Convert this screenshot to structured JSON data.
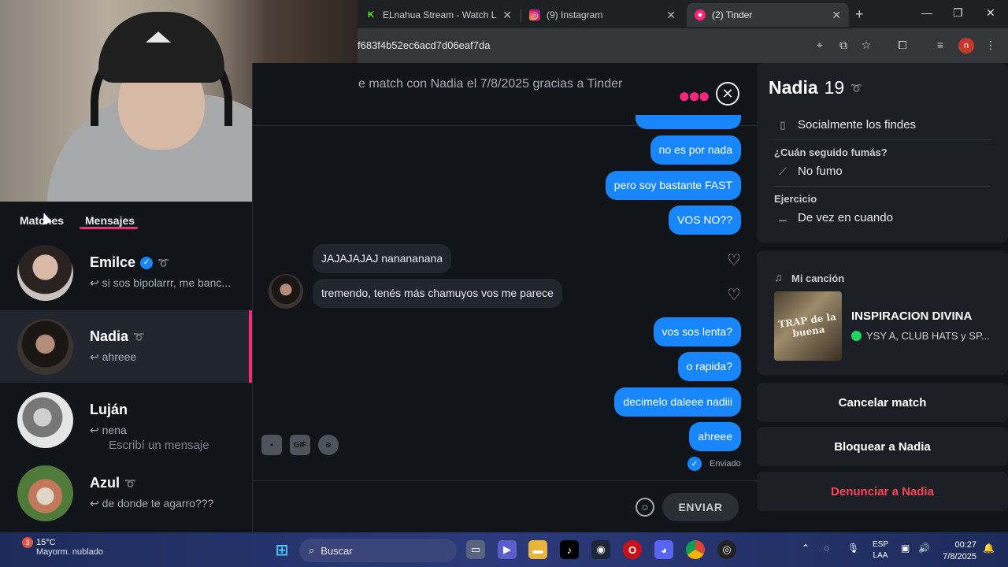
{
  "browser": {
    "tabs": [
      {
        "title": "ELnahua Stream - Watch Live",
        "favicon": "kick-icon",
        "active": false
      },
      {
        "title": "(9) Instagram",
        "favicon": "instagram-icon",
        "active": false
      },
      {
        "title": "(2) Tinder",
        "favicon": "tinder-icon",
        "active": true
      }
    ],
    "url": "f683f4b52ec6acd7d06eaf7da",
    "profile_initial": "n"
  },
  "sidebar": {
    "tab_matches": "Matches",
    "tab_messages": "Mensajes",
    "conversations": [
      {
        "name": "Emilce",
        "last": "si sos bipolarrr, me banc...",
        "verified": true
      },
      {
        "name": "Nadia",
        "last": "ahreee",
        "selected": true
      },
      {
        "name": "Luján",
        "last": "nena"
      },
      {
        "name": "Azul",
        "last": "de donde te agarro???"
      }
    ]
  },
  "chat": {
    "header": "e match con Nadia el 7/8/2025 gracias a Tinder",
    "messages": [
      {
        "from": "me",
        "text": "no es por nada"
      },
      {
        "from": "me",
        "text": "pero soy bastante FAST"
      },
      {
        "from": "me",
        "text": "VOS NO??"
      },
      {
        "from": "them",
        "text": "JAJAJAJAJ nanananana"
      },
      {
        "from": "them",
        "text": "tremendo, tenés más chamuyos vos me parece"
      },
      {
        "from": "me",
        "text": "vos sos lenta?"
      },
      {
        "from": "me",
        "text": "o rapida?"
      },
      {
        "from": "me",
        "text": "decimelo daleee nadiii"
      },
      {
        "from": "me",
        "text": "ahreee"
      }
    ],
    "status": "Enviado",
    "composer": {
      "placeholder": "Escribí un mensaje",
      "gif_label": "GIF",
      "send_label": "ENVIAR"
    }
  },
  "profile": {
    "name": "Nadia",
    "age": "19",
    "drinking": "Socialmente los findes",
    "smoking_label": "¿Cuán seguido fumás?",
    "smoking": "No fumo",
    "exercise_label": "Ejercicio",
    "exercise": "De vez en cuando",
    "song_label": "Mi canción",
    "song": {
      "title": "INSPIRACION DIVINA",
      "artists": "YSY A, CLUB HATS y SP...",
      "album_text": "TRAP de la buena"
    },
    "actions": {
      "unmatch": "Cancelar match",
      "block": "Bloquear a Nadia",
      "report": "Denunciar a Nadia"
    }
  },
  "taskbar": {
    "weather_temp": "15°C",
    "weather_desc": "Mayorm. nublado",
    "weather_badge": "3",
    "search_label": "Buscar",
    "lang_line1": "ESP",
    "lang_line2": "LAA",
    "time": "00:27",
    "date": "7/8/2025"
  },
  "colors": {
    "tinder_pink": "#fd267a",
    "message_blue": "#1786ff",
    "danger_red": "#ff4458",
    "bg": "#111418"
  }
}
